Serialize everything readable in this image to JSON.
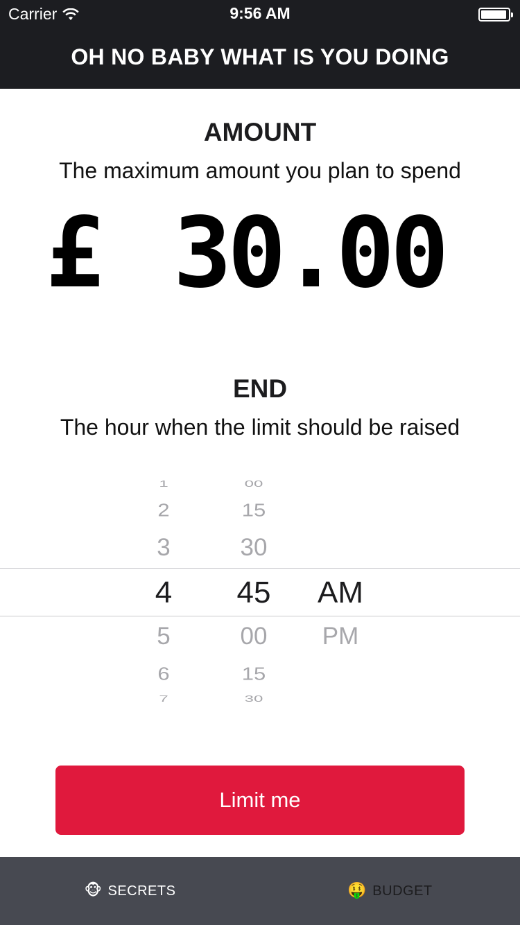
{
  "status_bar": {
    "carrier": "Carrier",
    "time": "9:56 AM"
  },
  "nav": {
    "title": "OH NO BABY WHAT IS YOU DOING"
  },
  "amount_section": {
    "title": "AMOUNT",
    "subtitle": "The maximum amount you plan to spend",
    "currency_symbol": "£",
    "value": "30.00"
  },
  "end_section": {
    "title": "END",
    "subtitle": "The hour when the limit should be raised"
  },
  "time_picker": {
    "hours": [
      "1",
      "2",
      "3",
      "4",
      "5",
      "6",
      "7"
    ],
    "minutes": [
      "00",
      "15",
      "30",
      "45",
      "00",
      "15",
      "30"
    ],
    "periods": [
      "AM",
      "PM"
    ],
    "selected": {
      "hour": "4",
      "minute": "45",
      "period": "AM"
    }
  },
  "primary_button": {
    "label": "Limit me",
    "color": "#e0193d"
  },
  "tab_bar": {
    "tabs": [
      {
        "icon": "🐵",
        "icon_name": "monkey-face-icon",
        "label": "SECRETS",
        "active": true
      },
      {
        "icon": "🤑",
        "icon_name": "money-mouth-face-icon",
        "label": "BUDGET",
        "active": false
      }
    ]
  }
}
